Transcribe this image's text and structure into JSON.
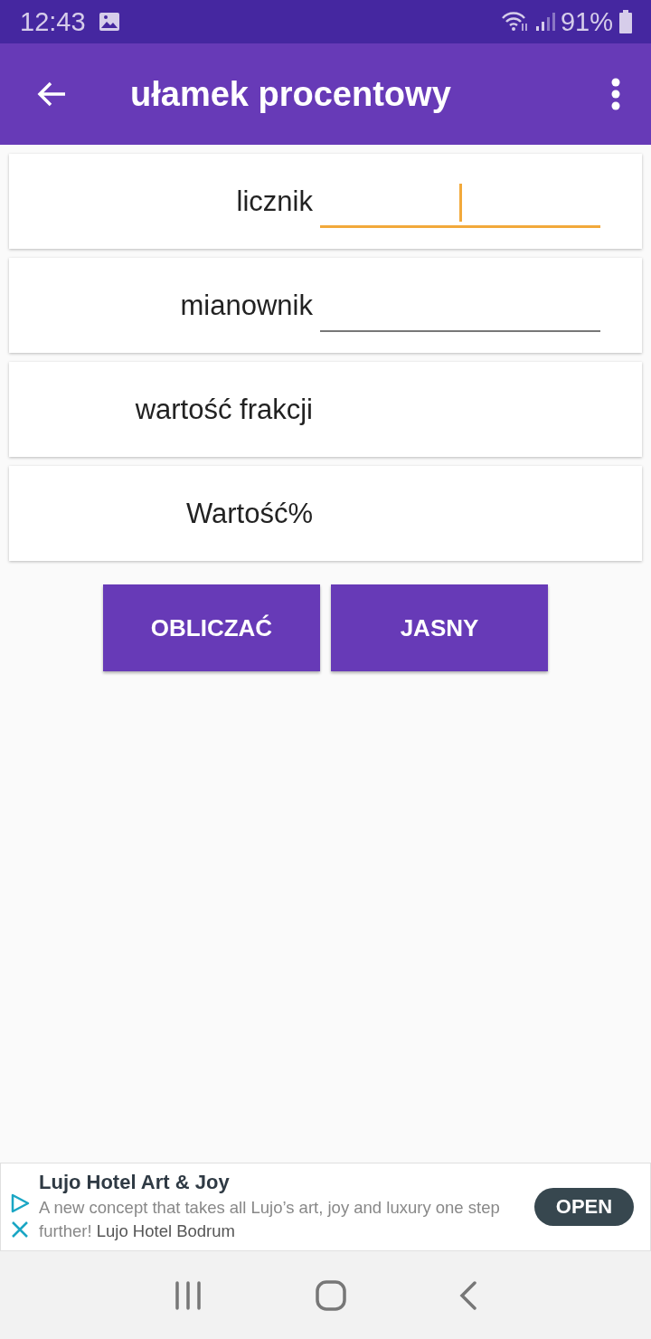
{
  "status_bar": {
    "time": "12:43",
    "battery": "91%"
  },
  "app_bar": {
    "title": "ułamek procentowy"
  },
  "rows": [
    {
      "kind": "input",
      "label": "licznik",
      "focused": true
    },
    {
      "kind": "input",
      "label": "mianownik",
      "focused": false
    },
    {
      "kind": "output",
      "label": "wartość frakcji"
    },
    {
      "kind": "output",
      "label": "Wartość%"
    }
  ],
  "buttons": [
    "OBLICZAĆ",
    "JASNY"
  ],
  "ad": {
    "title": "Lujo Hotel Art & Joy",
    "description": "A new concept that takes all Lujo’s art, joy and luxury one step further!",
    "advertiser": "Lujo Hotel Bodrum",
    "button": "OPEN"
  }
}
